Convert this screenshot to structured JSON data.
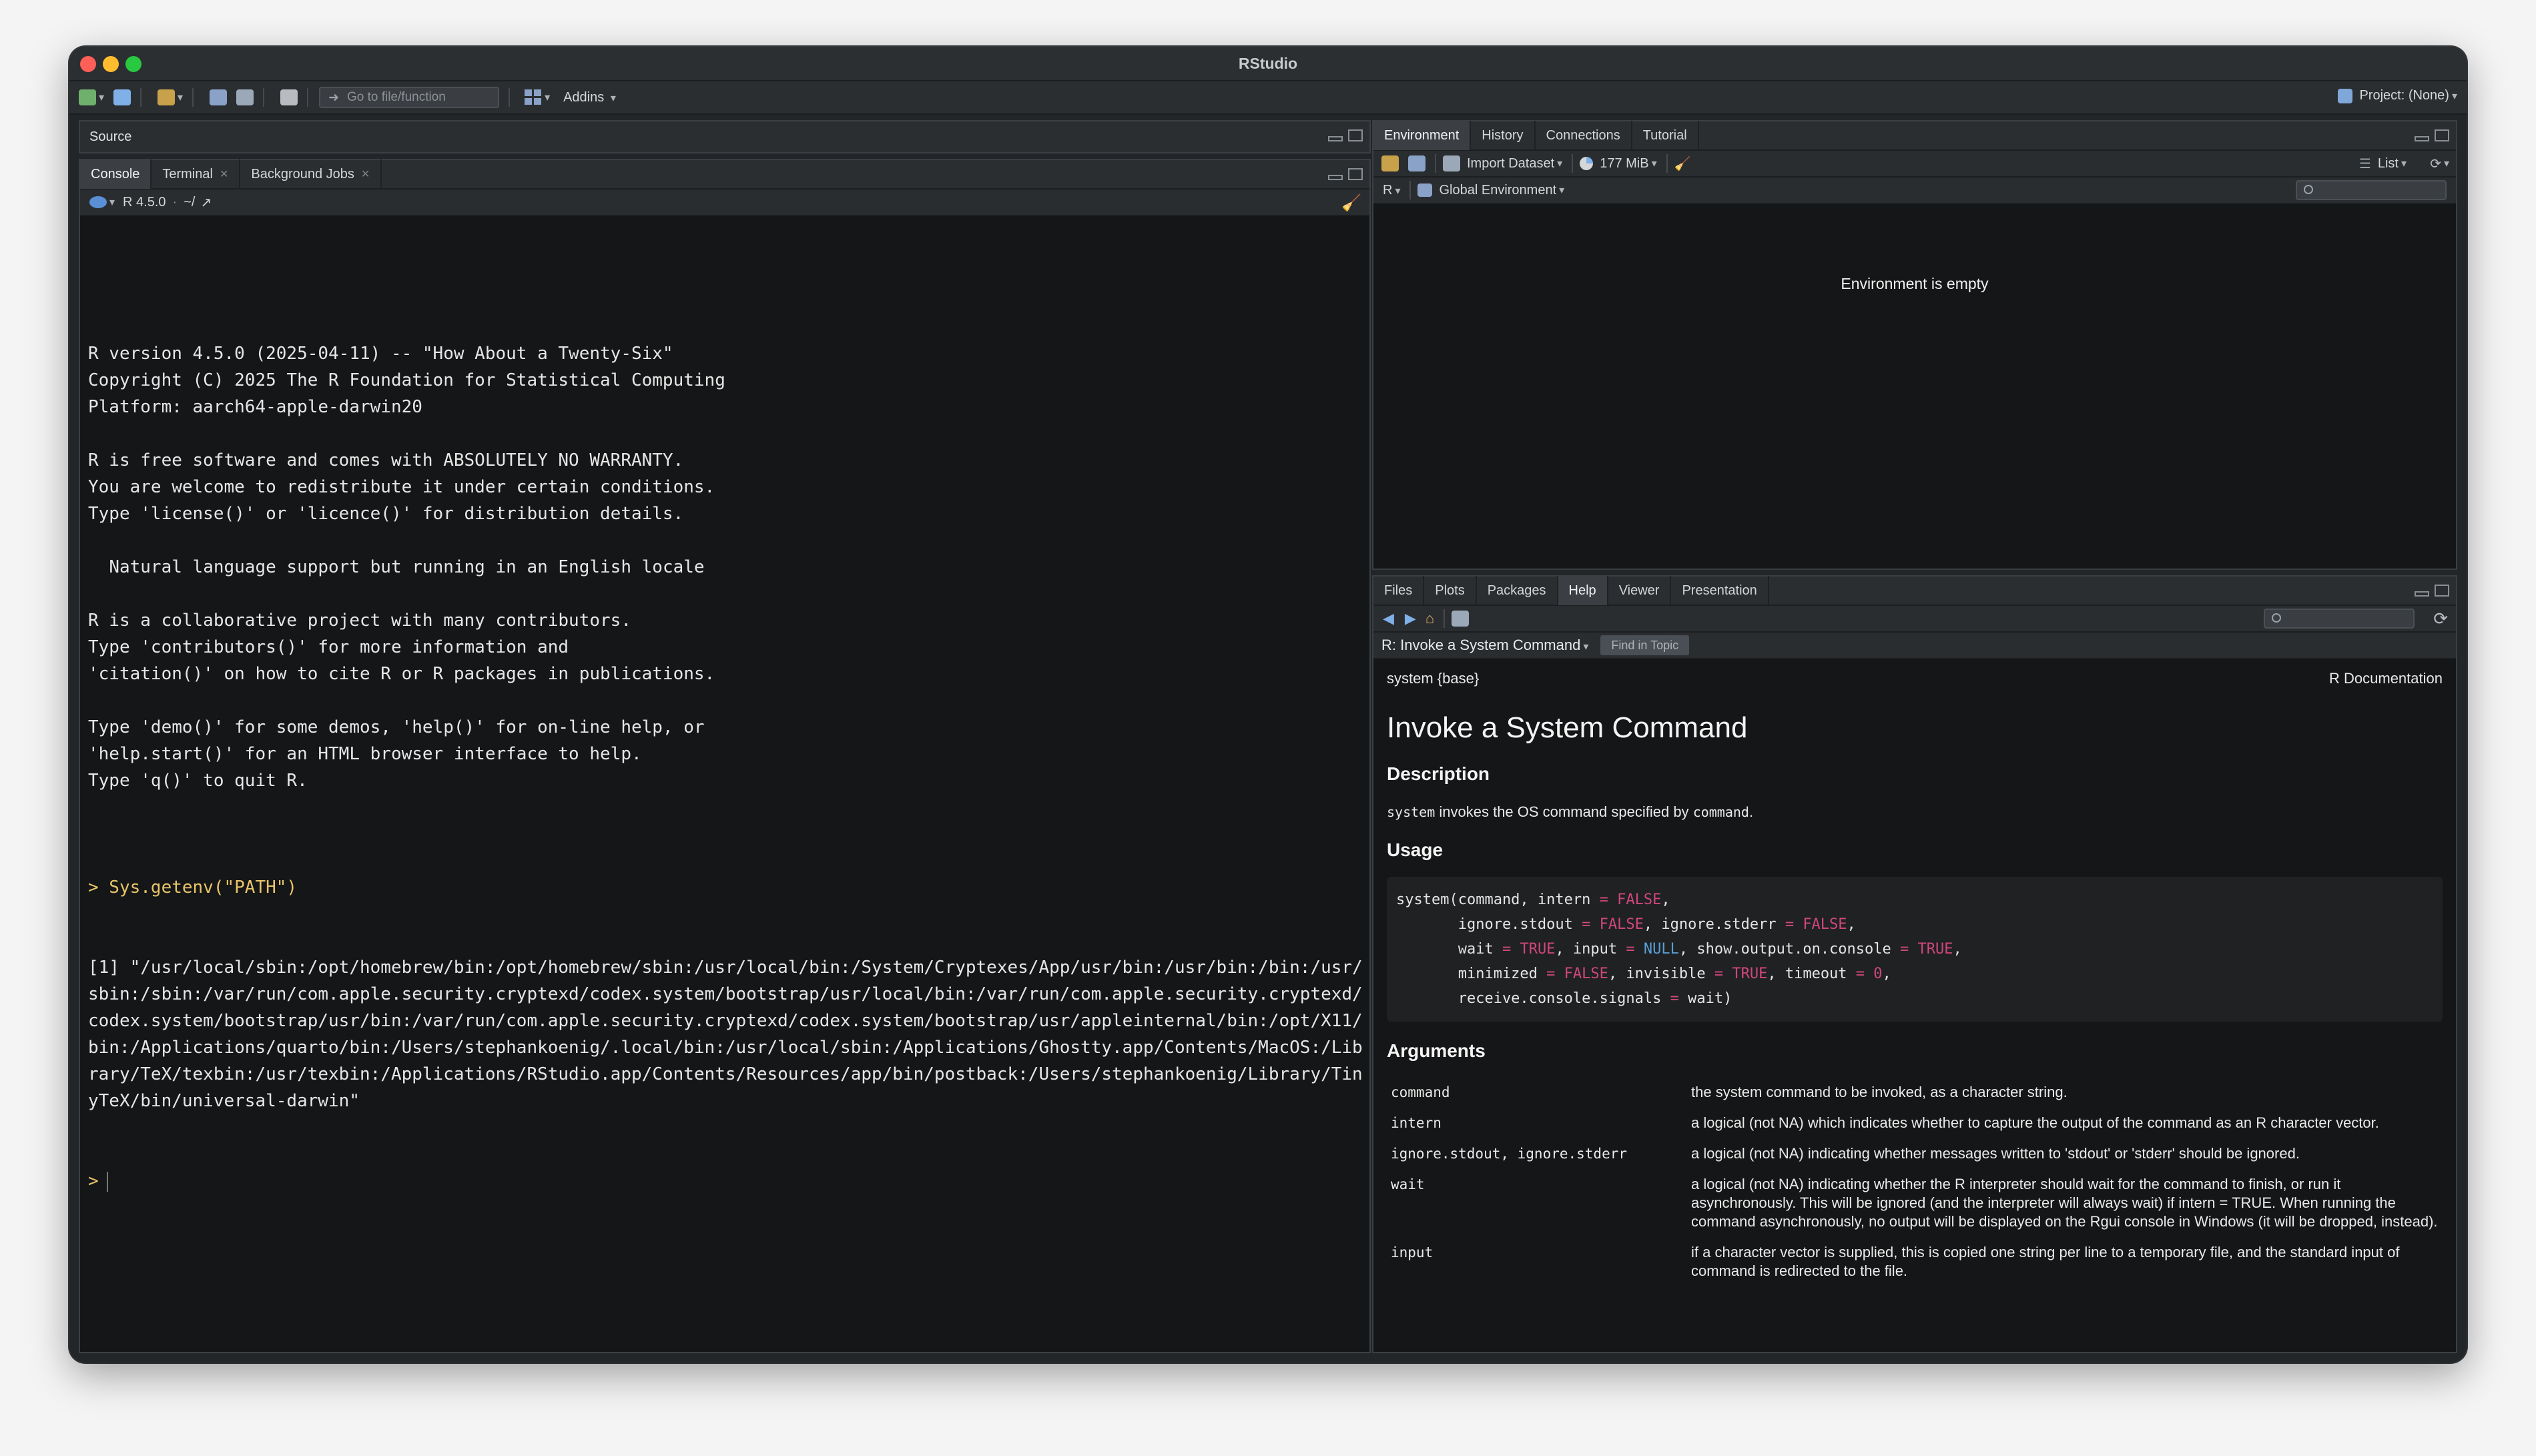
{
  "window": {
    "title": "RStudio"
  },
  "toolbar": {
    "goto_placeholder": "Go to file/function",
    "addins": "Addins",
    "project": "Project: (None)"
  },
  "source": {
    "title": "Source"
  },
  "console": {
    "tabs": [
      {
        "label": "Console"
      },
      {
        "label": "Terminal"
      },
      {
        "label": "Background Jobs"
      }
    ],
    "r_version": "R 4.5.0",
    "path": "~/",
    "lines": [
      "R version 4.5.0 (2025-04-11) -- \"How About a Twenty-Six\"",
      "Copyright (C) 2025 The R Foundation for Statistical Computing",
      "Platform: aarch64-apple-darwin20",
      "",
      "R is free software and comes with ABSOLUTELY NO WARRANTY.",
      "You are welcome to redistribute it under certain conditions.",
      "Type 'license()' or 'licence()' for distribution details.",
      "",
      "  Natural language support but running in an English locale",
      "",
      "R is a collaborative project with many contributors.",
      "Type 'contributors()' for more information and",
      "'citation()' on how to cite R or R packages in publications.",
      "",
      "Type 'demo()' for some demos, 'help()' for on-line help, or",
      "'help.start()' for an HTML browser interface to help.",
      "Type 'q()' to quit R.",
      ""
    ],
    "command": "> Sys.getenv(\"PATH\")",
    "output": "[1] \"/usr/local/sbin:/opt/homebrew/bin:/opt/homebrew/sbin:/usr/local/bin:/System/Cryptexes/App/usr/bin:/usr/bin:/bin:/usr/sbin:/sbin:/var/run/com.apple.security.cryptexd/codex.system/bootstrap/usr/local/bin:/var/run/com.apple.security.cryptexd/codex.system/bootstrap/usr/bin:/var/run/com.apple.security.cryptexd/codex.system/bootstrap/usr/appleinternal/bin:/opt/X11/bin:/Applications/quarto/bin:/Users/stephankoenig/.local/bin:/usr/local/sbin:/Applications/Ghostty.app/Contents/MacOS:/Library/TeX/texbin:/usr/texbin:/Applications/RStudio.app/Contents/Resources/app/bin/postback:/Users/stephankoenig/Library/TinyTeX/bin/universal-darwin\"",
    "prompt": ">"
  },
  "environment": {
    "tabs": [
      {
        "label": "Environment"
      },
      {
        "label": "History"
      },
      {
        "label": "Connections"
      },
      {
        "label": "Tutorial"
      }
    ],
    "import_dataset": "Import Dataset",
    "memory": "177 MiB",
    "view_mode": "List",
    "language": "R",
    "scope": "Global Environment",
    "empty_message": "Environment is empty"
  },
  "files": {
    "tabs": [
      {
        "label": "Files"
      },
      {
        "label": "Plots"
      },
      {
        "label": "Packages"
      },
      {
        "label": "Help"
      },
      {
        "label": "Viewer"
      },
      {
        "label": "Presentation"
      }
    ]
  },
  "help": {
    "topic": "R: Invoke a System Command",
    "find_in_topic": "Find in Topic",
    "package": "system {base}",
    "doc_label": "R Documentation",
    "title": "Invoke a System Command",
    "description_heading": "Description",
    "description_code1": "system",
    "description_text": "invokes the OS command specified by",
    "description_code2": "command",
    "description_end": ".",
    "usage_heading": "Usage",
    "arguments_heading": "Arguments",
    "arguments": [
      {
        "name": "command",
        "desc": "the system command to be invoked, as a character string."
      },
      {
        "name": "intern",
        "desc": "a logical (not NA) which indicates whether to capture the output of the command as an R character vector."
      },
      {
        "name": "ignore.stdout, ignore.stderr",
        "desc": "a logical (not NA) indicating whether messages written to 'stdout' or 'stderr' should be ignored."
      },
      {
        "name": "wait",
        "desc": "a logical (not NA) indicating whether the R interpreter should wait for the command to finish, or run it asynchronously. This will be ignored (and the interpreter will always wait) if intern = TRUE. When running the command asynchronously, no output will be displayed on the Rgui console in Windows (it will be dropped, instead)."
      },
      {
        "name": "input",
        "desc": "if a character vector is supplied, this is copied one string per line to a temporary file, and the standard input of command is redirected to the file."
      }
    ]
  },
  "colors": {
    "accent": "#e8c46a",
    "keyword": "#d0477a",
    "null": "#5a9fd6"
  }
}
